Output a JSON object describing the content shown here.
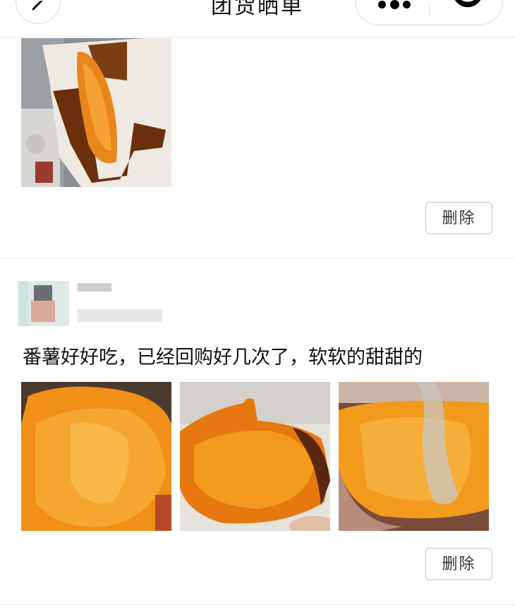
{
  "header": {
    "title": "团货晒单",
    "back_icon": "chevron-left-icon",
    "more_icon": "more-dots-icon",
    "close_icon": "target-icon"
  },
  "posts": [
    {
      "photos": [
        "roasted-sweet-potato-photo"
      ],
      "delete_label": "删除"
    },
    {
      "review": "番薯好好吃，已经回购好几次了，软软的甜甜的",
      "photos": [
        "sweet-potato-photo-1",
        "sweet-potato-photo-2",
        "sweet-potato-photo-3"
      ],
      "delete_label": "删除"
    }
  ],
  "colors": {
    "background": "#ffffff",
    "divider": "#e9e9e9",
    "button_border": "#c4c4c4",
    "potato_orange": "#f29a1c"
  }
}
